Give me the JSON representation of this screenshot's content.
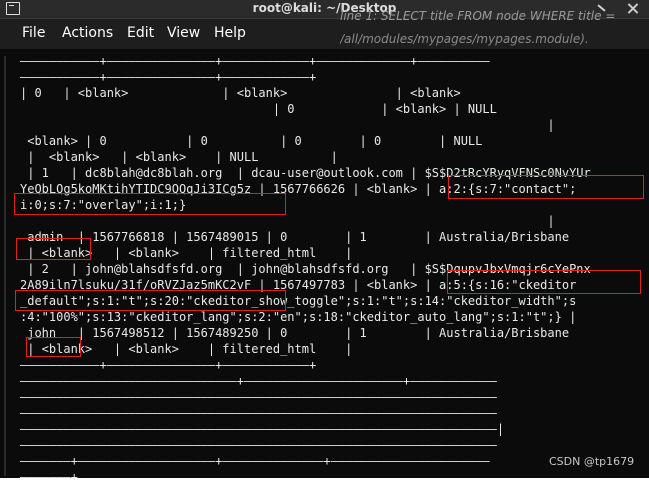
{
  "window": {
    "title": "root@kali: ~/Desktop"
  },
  "menu": [
    "File",
    "Actions",
    "Edit",
    "View",
    "Help"
  ],
  "background_text": [
    "line 1: SELECT title FROM node WHERE title =",
    "/all/modules/mypages/mypages.module)."
  ],
  "terminal_lines": [
    "———————————+———————————————+————————————+—————————————+——————————",
    "———————————+———————————————+————————————+",
    "| 0   | <blank>             | <blank>               | <blank>",
    "                                   | 0            | <blank> | NULL",
    "                                                                         |",
    " <blank> | 0           | 0          | 0        | 0        | NULL",
    " |  <blank>   | <blank>    | NULL          |",
    " | 1   | dc8blah@dc8blah.org  | dcau-user@outlook.com | $S$D2tRcYRyqVFNSc0NvYUr",
    "YeQbLQg5koMKtihYTIDC9QQqJi3ICg5z | 1567766626 | <blank> | a:2:{s:7:\"contact\";",
    "i:0;s:7:\"overlay\";i:1;}",
    "                                                                         |",
    " admin  | 1567766818 | 1567489015 | 0        | 1        | Australia/Brisbane",
    " | <blank>   | <blank>    | filtered_html    |",
    " | 2   | john@blahsdfsfd.org  | john@blahsdfsfd.org   | $S$DqupvJbxVmqjr6cYePnx",
    "2A89iln7lsuku/31f/oRVZJaz5mKC2vF | 1567497783 | <blank> | a:5:{s:16:\"ckeditor",
    "_default\";s:1:\"t\";s:20:\"ckeditor_show_toggle\";s:1:\"t\";s:14:\"ckeditor_width\";s",
    ":4:\"100%\";s:13:\"ckeditor_lang\";s:2:\"en\";s:18:\"ckeditor_auto_lang\";s:1:\"t\";} |",
    " john   | 1567498512 | 1567489250 | 0        | 1        | Australia/Brisbane",
    " | <blank>   | <blank>    | filtered_html    |",
    "———————————+———————————————+————————————+",
    "——————————————————————————————+——————————————————————+————————————",
    "——————————————————————————————————————————————————————————————————",
    "——————————————————————————————————————————————————————————————————",
    "——————————————————————————————————————————————————————————————————|",
    "——————————————————————————————————————————————————————————————————",
    "———————+———————————————————+——————————————+——————————————————————",
    "———————+"
  ],
  "watermark": "CSDN @tp1679",
  "colors": {
    "terminal_bg": "#0b0b0b",
    "terminal_fg": "#e8e8e8",
    "highlight_box": "#e02020"
  }
}
